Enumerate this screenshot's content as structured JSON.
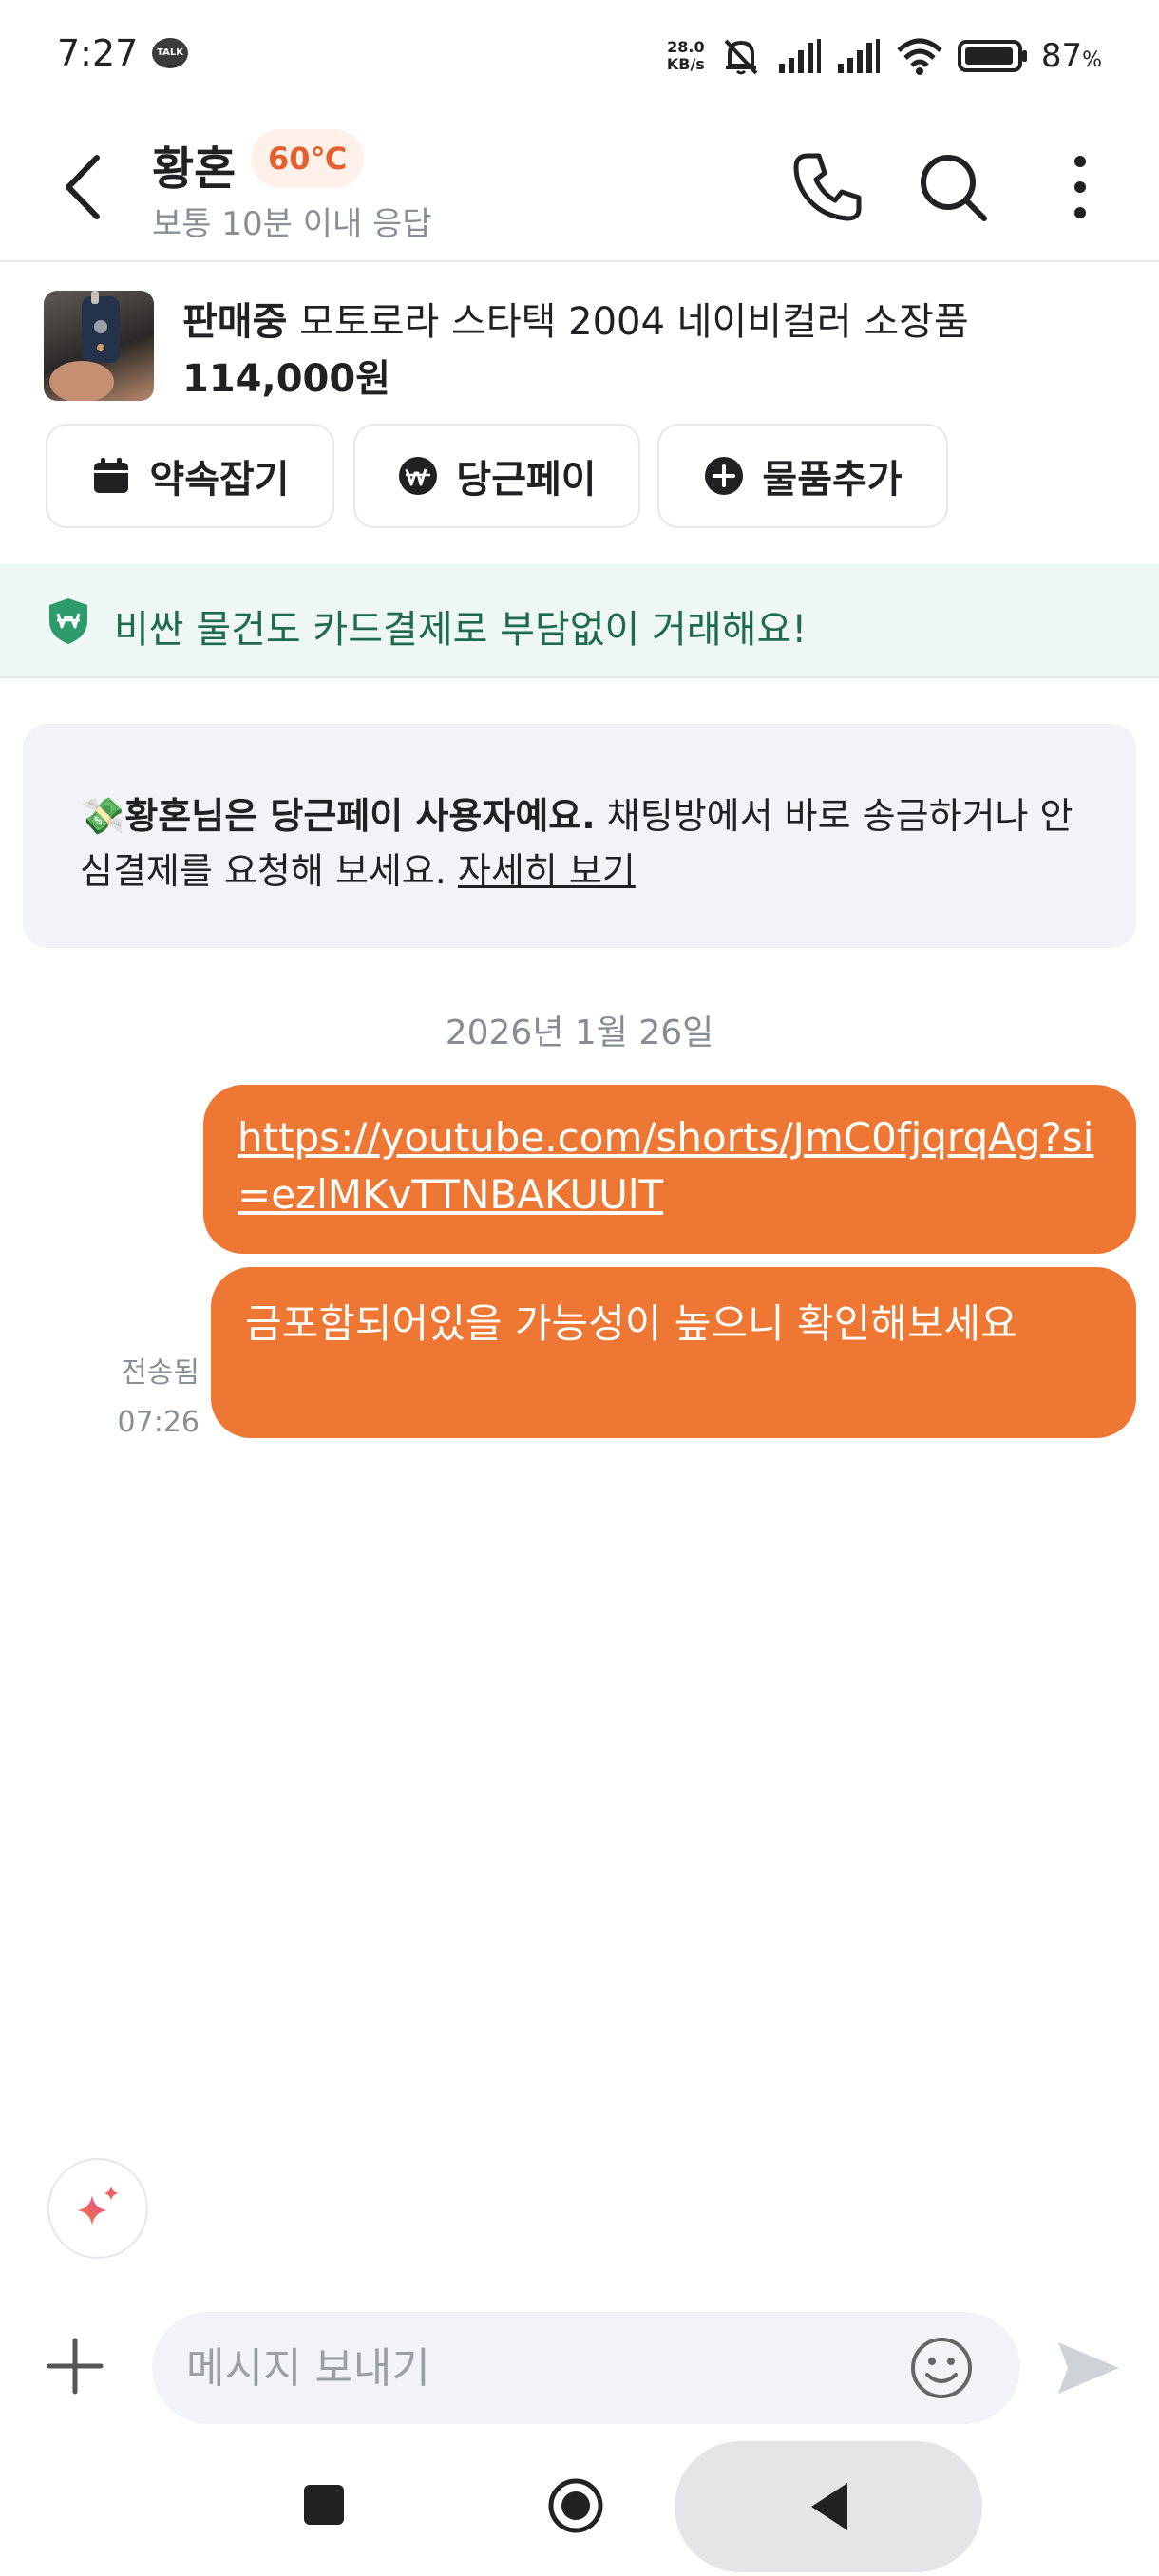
{
  "status_bar": {
    "time": "7:27",
    "talk_badge": "TALK",
    "net_speed_value": "28.0",
    "net_speed_unit": "KB/s",
    "battery_percent": "87",
    "battery_percent_sign": "%"
  },
  "header": {
    "title": "황혼",
    "temperature": "60℃",
    "subtitle": "보통 10분 이내 응답"
  },
  "product": {
    "status": "판매중",
    "name": "모토로라 스타택 2004 네이비컬러 소장품",
    "price": "114,000원",
    "buttons": [
      {
        "label": "약속잡기",
        "icon": "calendar-icon"
      },
      {
        "label": "당근페이",
        "icon": "won-coin-icon"
      },
      {
        "label": "물품추가",
        "icon": "plus-circle-icon"
      }
    ]
  },
  "banner": {
    "text": "비싼 물건도 카드결제로 부담없이 거래해요!"
  },
  "info_card": {
    "emoji": "💸",
    "bold": "황혼님은 당근페이 사용자예요.",
    "text": " 채팅방에서 바로 송금하거나 안심결제를 요청해 보세요. ",
    "link": "자세히 보기"
  },
  "chat": {
    "date": "2026년 1월 26일",
    "messages": [
      {
        "text": "https://youtube.com/shorts/JmC0fjqrqAg?si=ezlMKvTTNBAKUUlT"
      },
      {
        "text": "금포함되어있을 가능성이 높으니 확인해보세요",
        "status": "전송됨",
        "time": "07:26"
      }
    ]
  },
  "input": {
    "placeholder": "메시지 보내기"
  },
  "colors": {
    "bubble": "#ee7733",
    "banner_bg": "#eef7f3",
    "banner_text": "#1d6a4c",
    "temperature": "#e35f2d"
  }
}
